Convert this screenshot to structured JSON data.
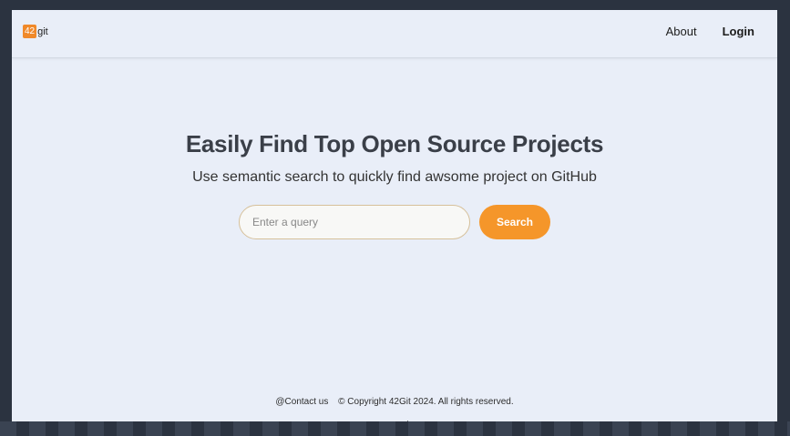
{
  "logo": {
    "badge": "42",
    "text": "git"
  },
  "nav": {
    "about": "About",
    "login": "Login"
  },
  "hero": {
    "title": "Easily Find Top Open Source Projects",
    "subtitle": "Use semantic search to quickly find awsome project on GitHub"
  },
  "search": {
    "placeholder": "Enter a query",
    "button_label": "Search"
  },
  "footer": {
    "contact": "@Contact us",
    "copyright": "© Copyright 42Git 2024. All rights reserved."
  },
  "colors": {
    "accent": "#f5962a",
    "background": "#e9eef8"
  }
}
